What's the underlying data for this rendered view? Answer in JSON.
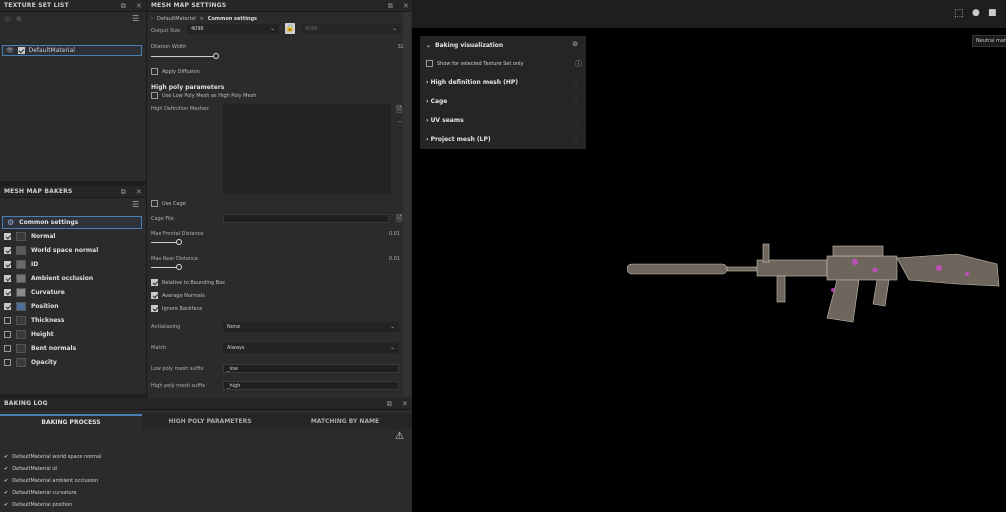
{
  "texture_set_list": {
    "title": "TEXTURE SET LIST",
    "items": [
      {
        "label": "DefaultMaterial"
      }
    ]
  },
  "mesh_map_settings": {
    "title": "MESH MAP SETTINGS",
    "breadcrumb": {
      "material": "DefaultMaterial",
      "separator": ">",
      "section": "Common settings"
    },
    "output_size": {
      "label": "Output Size",
      "value": "4096",
      "locked_value": "4096"
    },
    "dilation_width": {
      "label": "Dilation Width",
      "value": "32"
    },
    "apply_diffusion": {
      "label": "Apply Diffusion",
      "checked": false
    },
    "high_poly": {
      "heading": "High poly parameters",
      "use_low_poly_label": "Use Low Poly Mesh as High Poly Mesh",
      "meshes_label": "High Definition Meshes"
    },
    "use_cage": {
      "label": "Use Cage",
      "checked": false
    },
    "cage_file": {
      "label": "Cage File",
      "value": ""
    },
    "max_frontal": {
      "label": "Max Frontal Distance",
      "value": "0.01"
    },
    "max_rear": {
      "label": "Max Rear Distance",
      "value": "0.01"
    },
    "relative_bbox": {
      "label": "Relative to Bounding Box",
      "checked": true
    },
    "average_normals": {
      "label": "Average Normals",
      "checked": true
    },
    "ignore_backface": {
      "label": "Ignore Backface",
      "checked": true
    },
    "antialiasing": {
      "label": "Antialiasing",
      "value": "None"
    },
    "match": {
      "label": "Match",
      "value": "Always"
    },
    "low_suffix": {
      "label": "Low poly mesh suffix",
      "value": "_low"
    },
    "high_suffix": {
      "label": "High poly mesh suffix",
      "value": "_high"
    }
  },
  "mesh_map_bakers": {
    "title": "MESH MAP BAKERS",
    "common": "Common settings",
    "items": [
      {
        "label": "Normal",
        "checked": true,
        "icon": "normal-map-icon"
      },
      {
        "label": "World space normal",
        "checked": true,
        "icon": "world-normal-icon"
      },
      {
        "label": "ID",
        "checked": true,
        "icon": "id-map-icon"
      },
      {
        "label": "Ambient occlusion",
        "checked": true,
        "icon": "ao-map-icon"
      },
      {
        "label": "Curvature",
        "checked": true,
        "icon": "curvature-map-icon"
      },
      {
        "label": "Position",
        "checked": true,
        "icon": "position-map-icon"
      },
      {
        "label": "Thickness",
        "checked": false,
        "icon": "thickness-map-icon"
      },
      {
        "label": "Height",
        "checked": false,
        "icon": "height-map-icon"
      },
      {
        "label": "Bent normals",
        "checked": false,
        "icon": "bent-normals-icon"
      },
      {
        "label": "Opacity",
        "checked": false,
        "icon": "opacity-map-icon"
      }
    ]
  },
  "baking_log": {
    "title": "BAKING LOG",
    "tabs": [
      {
        "label": "BAKING PROCESS",
        "active": true
      },
      {
        "label": "HIGH POLY PARAMETERS",
        "active": false
      },
      {
        "label": "MATCHING BY NAME",
        "active": false
      }
    ],
    "entries": [
      "DefaultMaterial world space normal",
      "DefaultMaterial id",
      "DefaultMaterial ambient occlusion",
      "DefaultMaterial curvature",
      "DefaultMaterial position"
    ]
  },
  "baking_visualization": {
    "title": "Baking visualization",
    "show_selected_label": "Show for selected Texture Set only",
    "sections": [
      "High definition mesh (HP)",
      "Cage",
      "UV seams",
      "Project mesh (LP)"
    ]
  },
  "viewport": {
    "tooltip": "Neutral mat"
  },
  "colors": {
    "accent": "#4a7fb5",
    "checkbox": "#c8c8c8",
    "wireframe": "#c9c0b0",
    "highlight": "#d04ad0"
  }
}
